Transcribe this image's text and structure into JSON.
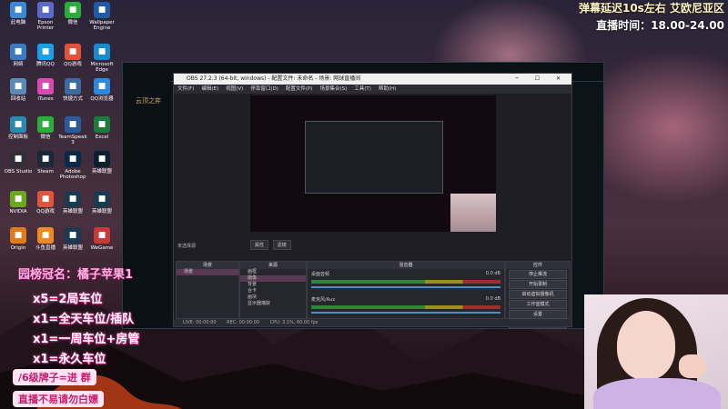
{
  "banner": {
    "line1": "弹幕延迟10s左右 艾欧尼亚区",
    "line2": "直播时间：18.00-24.00"
  },
  "desktop_icons": [
    {
      "label": "此电脑",
      "icon": "computer-icon",
      "color": "#3a8ad6"
    },
    {
      "label": "Epson Printer",
      "icon": "printer-icon",
      "color": "#5a6ac8"
    },
    {
      "label": "微信",
      "icon": "wechat-icon",
      "color": "#2aae3a"
    },
    {
      "label": "Wallpaper Engine",
      "icon": "wallpaper-icon",
      "color": "#1e5aa8"
    },
    {
      "label": "网络",
      "icon": "network-icon",
      "color": "#3a7ac0"
    },
    {
      "label": "腾讯QQ",
      "icon": "qq-icon",
      "color": "#1aa0e8"
    },
    {
      "label": "QQ游戏",
      "icon": "qq-game-icon",
      "color": "#e0553a"
    },
    {
      "label": "Microsoft Edge",
      "icon": "edge-icon",
      "color": "#1a8ad0"
    },
    {
      "label": "回收站",
      "icon": "recycle-bin-icon",
      "color": "#5a8ab8"
    },
    {
      "label": "iTunes",
      "icon": "itunes-icon",
      "color": "#d84ab0"
    },
    {
      "label": "快捷方式",
      "icon": "shortcut-icon",
      "color": "#3a6aa0"
    },
    {
      "label": "QQ浏览器",
      "icon": "qq-browser-icon",
      "color": "#2a8ae0"
    },
    {
      "label": "控制面板",
      "icon": "control-panel-icon",
      "color": "#2a8ab0"
    },
    {
      "label": "微信",
      "icon": "wechat-icon",
      "color": "#2aae3a"
    },
    {
      "label": "TeamSpeak 3",
      "icon": "teamspeak-icon",
      "color": "#2a5a9a"
    },
    {
      "label": "Excel",
      "icon": "excel-icon",
      "color": "#1e7a3e"
    },
    {
      "label": "OBS Studio",
      "icon": "obs-icon",
      "color": "#303038"
    },
    {
      "label": "Steam",
      "icon": "steam-icon",
      "color": "#1b2838"
    },
    {
      "label": "Adobe Photoshop",
      "icon": "photoshop-icon",
      "color": "#0a2a4a"
    },
    {
      "label": "英雄联盟",
      "icon": "game-icon",
      "color": "#0a2030"
    },
    {
      "label": "NVIDIA",
      "icon": "nvidia-icon",
      "color": "#6aa820"
    },
    {
      "label": "QQ游戏",
      "icon": "qq-game-icon",
      "color": "#e0553a"
    },
    {
      "label": "英雄联盟",
      "icon": "lol-icon",
      "color": "#1a3a50"
    },
    {
      "label": "英雄联盟",
      "icon": "lol-icon",
      "color": "#1a3a50"
    },
    {
      "label": "Origin",
      "icon": "origin-icon",
      "color": "#e07a1a"
    },
    {
      "label": "斗鱼直播",
      "icon": "douyu-icon",
      "color": "#f08a20"
    },
    {
      "label": "英雄联盟",
      "icon": "lol-icon",
      "color": "#1a3a50"
    },
    {
      "label": "WeGame",
      "icon": "wegame-icon",
      "color": "#c83a3a"
    }
  ],
  "game_window": {
    "label": "云顶之弈"
  },
  "obs": {
    "title": "OBS 27.2.3 (64-bit, windows) - 配置文件: 未命名 - 场景: 网球直播间",
    "menu": [
      "文件(F)",
      "编辑(E)",
      "视图(V)",
      "停靠窗口(D)",
      "配置文件(P)",
      "场景集合(S)",
      "工具(T)",
      "帮助(H)"
    ],
    "preview_tools": [
      "属性",
      "滤镜"
    ],
    "scenes_header": "场景",
    "sources_header": "来源",
    "mixer_header": "混音器",
    "controls_header": "控件",
    "no_source": "未选择源",
    "scenes": [
      "场景",
      "场景 2"
    ],
    "sources": [
      "画框",
      "摄像",
      "背景",
      "合卡",
      "画块",
      "显示器捕获"
    ],
    "mixer_channels": [
      {
        "name": "桌面音频",
        "level": "0.0 dB"
      },
      {
        "name": "麦克风/Aux",
        "level": "0.0 dB"
      }
    ],
    "controls": [
      "停止推流",
      "开始录制",
      "启动虚拟摄像机",
      "工作室模式",
      "设置",
      "退出"
    ],
    "status": [
      "LIVE: 00:00:00",
      "REC: 00:00:00",
      "CPU: 3.1%, 60.00 fps"
    ]
  },
  "overlay": {
    "title": "园榜冠名：橘子苹果1",
    "lines": [
      "x5=2局车位",
      "x1=全天车位/插队",
      "x1=一周车位+房管",
      "x1=永久车位"
    ],
    "pill1": "/6级牌子=进 群",
    "pill2": "直播不易请勿白嫖"
  }
}
